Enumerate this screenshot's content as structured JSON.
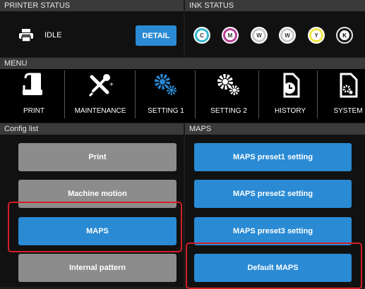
{
  "printer_status": {
    "header": "PRINTER STATUS",
    "state": "IDLE",
    "detail_button": "DETAIL"
  },
  "ink_status": {
    "header": "INK STATUS",
    "inks": [
      {
        "letter": "C",
        "color": "#33b6cf"
      },
      {
        "letter": "M",
        "color": "#b53f95"
      },
      {
        "letter": "W",
        "color": "#c9c9c9"
      },
      {
        "letter": "W",
        "color": "#c9c9c9"
      },
      {
        "letter": "Y",
        "color": "#f0e84a"
      },
      {
        "letter": "K",
        "color": "#111111"
      }
    ]
  },
  "menu": {
    "header": "MENU",
    "items": [
      {
        "label": "PRINT",
        "icon": "print-icon"
      },
      {
        "label": "MAINTENANCE",
        "icon": "maintenance-icon"
      },
      {
        "label": "SETTING 1",
        "icon": "settings-icon"
      },
      {
        "label": "SETTING 2",
        "icon": "settings-icon"
      },
      {
        "label": "HISTORY",
        "icon": "history-icon"
      },
      {
        "label": "SYSTEM",
        "icon": "system-icon"
      }
    ]
  },
  "config_list": {
    "header": "Config list",
    "items": [
      "Print",
      "Machine motion",
      "MAPS",
      "Internal pattern"
    ]
  },
  "maps": {
    "header": "MAPS",
    "items": [
      "MAPS preset1 setting",
      "MAPS preset2 setting",
      "MAPS preset3 setting",
      "Default MAPS"
    ]
  },
  "colors": {
    "accent_blue": "#2a8ad4",
    "button_gray": "#8c8c8c",
    "highlight_red": "#d31f26"
  }
}
